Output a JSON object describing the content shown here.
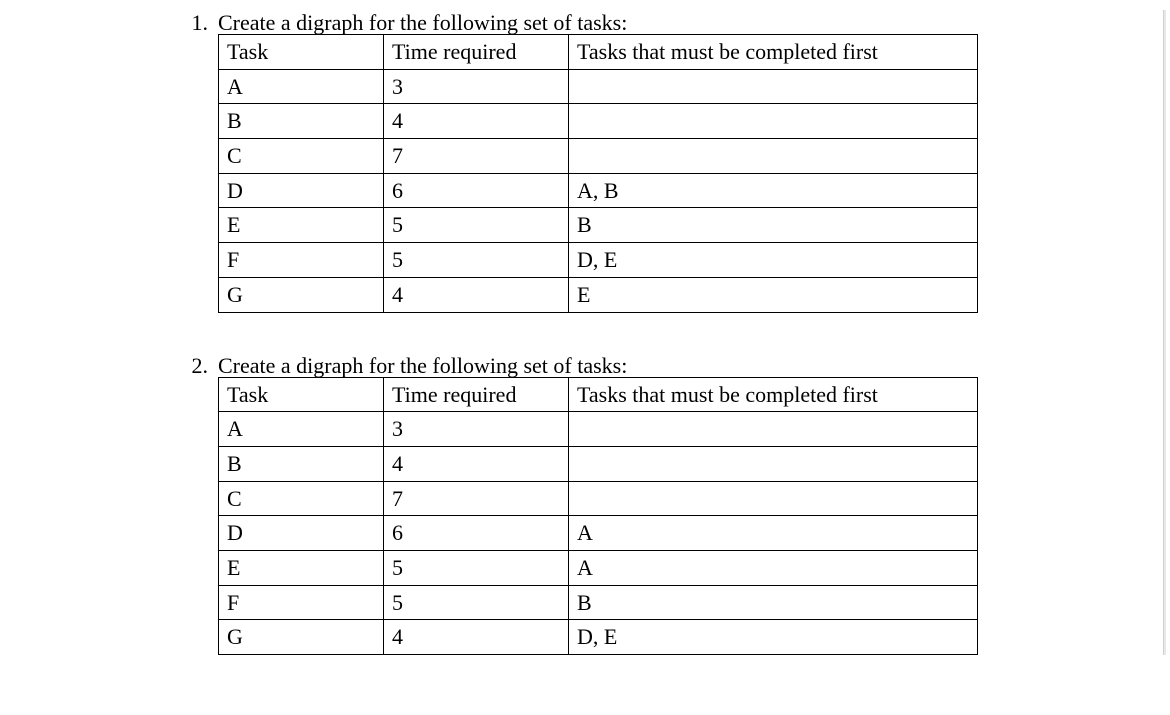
{
  "questions": [
    {
      "number": "1.",
      "prompt": "Create a digraph for the following set of tasks:",
      "headers": [
        "Task",
        "Time required",
        "Tasks that must be completed first"
      ],
      "rows": [
        {
          "task": "A",
          "time": "3",
          "prereq": ""
        },
        {
          "task": "B",
          "time": "4",
          "prereq": ""
        },
        {
          "task": "C",
          "time": "7",
          "prereq": ""
        },
        {
          "task": "D",
          "time": "6",
          "prereq": "A, B"
        },
        {
          "task": "E",
          "time": "5",
          "prereq": "B"
        },
        {
          "task": "F",
          "time": "5",
          "prereq": "D, E"
        },
        {
          "task": "G",
          "time": "4",
          "prereq": "E"
        }
      ]
    },
    {
      "number": "2.",
      "prompt": "Create a digraph for the following set of tasks:",
      "headers": [
        "Task",
        "Time required",
        "Tasks that must be completed first"
      ],
      "rows": [
        {
          "task": "A",
          "time": "3",
          "prereq": ""
        },
        {
          "task": "B",
          "time": "4",
          "prereq": ""
        },
        {
          "task": "C",
          "time": "7",
          "prereq": ""
        },
        {
          "task": "D",
          "time": "6",
          "prereq": "A"
        },
        {
          "task": "E",
          "time": "5",
          "prereq": "A"
        },
        {
          "task": "F",
          "time": "5",
          "prereq": "B"
        },
        {
          "task": "G",
          "time": "4",
          "prereq": "D, E"
        }
      ]
    }
  ]
}
